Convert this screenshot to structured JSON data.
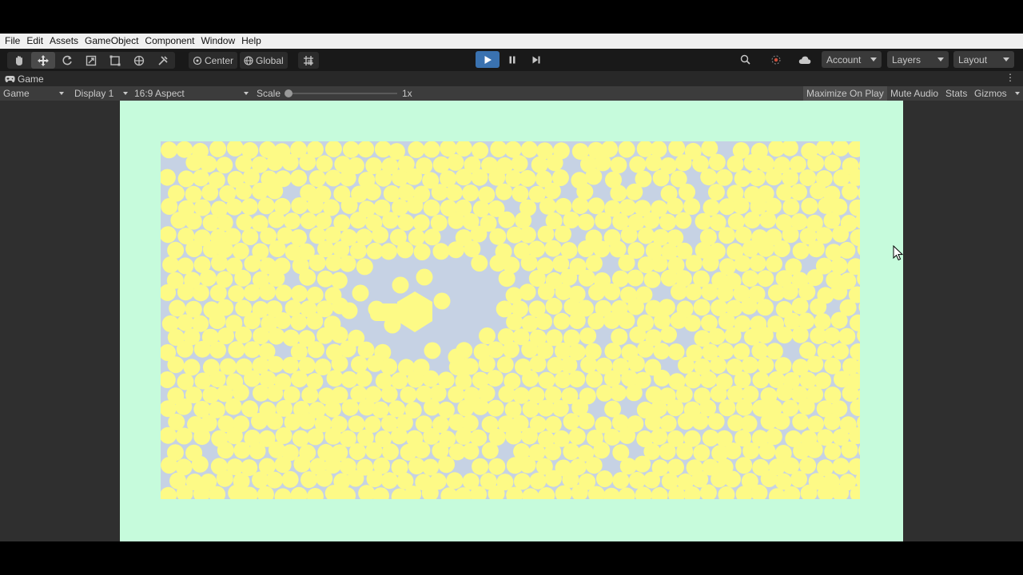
{
  "menubar": {
    "items": [
      "File",
      "Edit",
      "Assets",
      "GameObject",
      "Component",
      "Window",
      "Help"
    ]
  },
  "toolbar": {
    "tools": [
      {
        "name": "hand-tool",
        "glyph": "✋"
      },
      {
        "name": "move-tool",
        "glyph": "✥"
      },
      {
        "name": "rotate-tool",
        "glyph": "↻"
      },
      {
        "name": "scale-tool",
        "glyph": "⤢"
      },
      {
        "name": "rect-tool",
        "glyph": "⬚"
      },
      {
        "name": "transform-tool",
        "glyph": "✳"
      },
      {
        "name": "custom-tool",
        "glyph": "✂"
      }
    ],
    "pivot_mode": "Center",
    "pivot_rotation": "Global",
    "account_label": "Account",
    "layers_label": "Layers",
    "layout_label": "Layout"
  },
  "game_tab": {
    "title": "Game"
  },
  "game_controls": {
    "mode": "Game",
    "display": "Display 1",
    "aspect": "16:9 Aspect",
    "scale_label": "Scale",
    "scale_value": "1x",
    "maximize_on_play": "Maximize On Play",
    "mute_audio": "Mute Audio",
    "stats": "Stats",
    "gizmos": "Gizmos"
  },
  "colors": {
    "background_green": "#c6fbdc",
    "container_blue": "#c6d2e4",
    "particle_yellow": "#fdfa86",
    "play_accent": "#3a72b0"
  },
  "scene": {
    "particle_shape": "circle",
    "obstacle_shape": "hexagon"
  }
}
